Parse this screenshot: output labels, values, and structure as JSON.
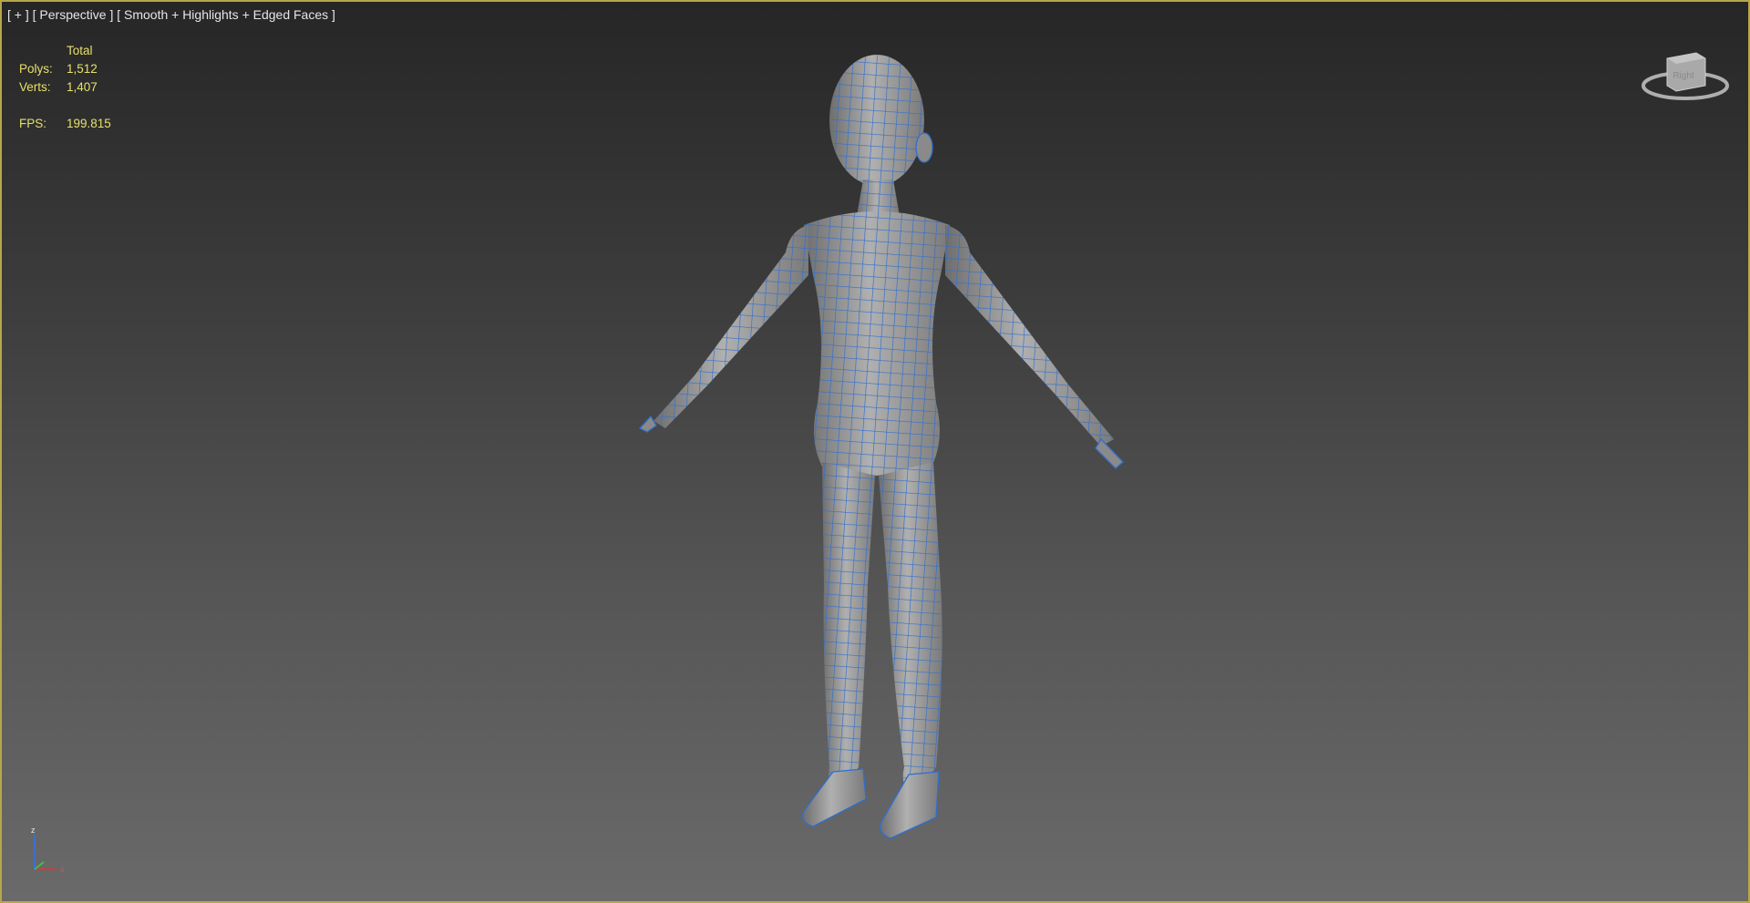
{
  "viewport": {
    "menu_plus": "[ + ]",
    "view_mode": "[ Perspective ]",
    "shading_mode": "[ Smooth + Highlights + Edged Faces ]"
  },
  "stats": {
    "header": "Total",
    "polys_label": "Polys:",
    "polys_value": "1,512",
    "verts_label": "Verts:",
    "verts_value": "1,407",
    "fps_label": "FPS:",
    "fps_value": "199.815"
  },
  "viewcube": {
    "label": "Right"
  },
  "axis": {
    "z": "z",
    "x": "x"
  },
  "colors": {
    "frame": "#b8a64a",
    "stats_text": "#e7e06a",
    "wire": "#2f6fd0",
    "mesh": "#9a9a9a"
  }
}
